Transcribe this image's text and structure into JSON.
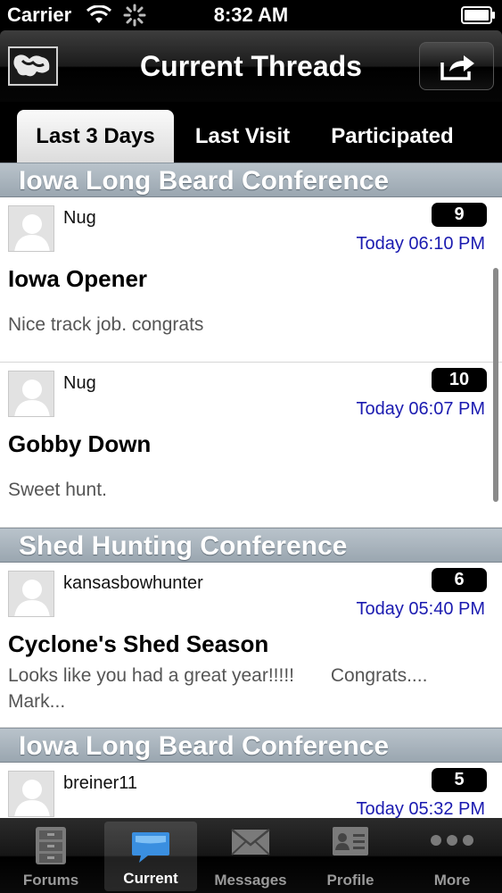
{
  "status_bar": {
    "carrier": "Carrier",
    "time": "8:32 AM"
  },
  "nav": {
    "title": "Current Threads"
  },
  "tabs": [
    {
      "label": "Last 3 Days",
      "active": true
    },
    {
      "label": "Last Visit",
      "active": false
    },
    {
      "label": "Participated",
      "active": false
    }
  ],
  "sections": [
    {
      "header": "Iowa Long Beard Conference",
      "threads": [
        {
          "author": "Nug",
          "count": "9",
          "time": "Today 06:10 PM",
          "title": "Iowa Opener",
          "preview": "Nice track job. congrats"
        },
        {
          "author": "Nug",
          "count": "10",
          "time": "Today 06:07 PM",
          "title": "Gobby Down",
          "preview": "Sweet hunt."
        }
      ]
    },
    {
      "header": "Shed Hunting Conference",
      "threads": [
        {
          "author": "kansasbowhunter",
          "count": "6",
          "time": "Today 05:40 PM",
          "title": "Cyclone's Shed Season",
          "preview_line1": "Looks like you had a great year!!!!!       Congrats....",
          "preview_line2": "Mark..."
        }
      ]
    },
    {
      "header": "Iowa Long Beard Conference",
      "threads": [
        {
          "author": "breiner11",
          "count": "5",
          "time": "Today 05:32 PM"
        }
      ]
    }
  ],
  "tab_bar": [
    {
      "label": "Forums",
      "icon": "cabinet-icon"
    },
    {
      "label": "Current",
      "icon": "speech-bubble-icon",
      "active": true
    },
    {
      "label": "Messages",
      "icon": "envelope-icon"
    },
    {
      "label": "Profile",
      "icon": "id-card-icon"
    },
    {
      "label": "More",
      "icon": "more-dots-icon"
    }
  ],
  "colors": {
    "time_text": "#1a1ab0",
    "section_header": "#9aa6b0",
    "active_tab_icon": "#3a8fe0"
  }
}
